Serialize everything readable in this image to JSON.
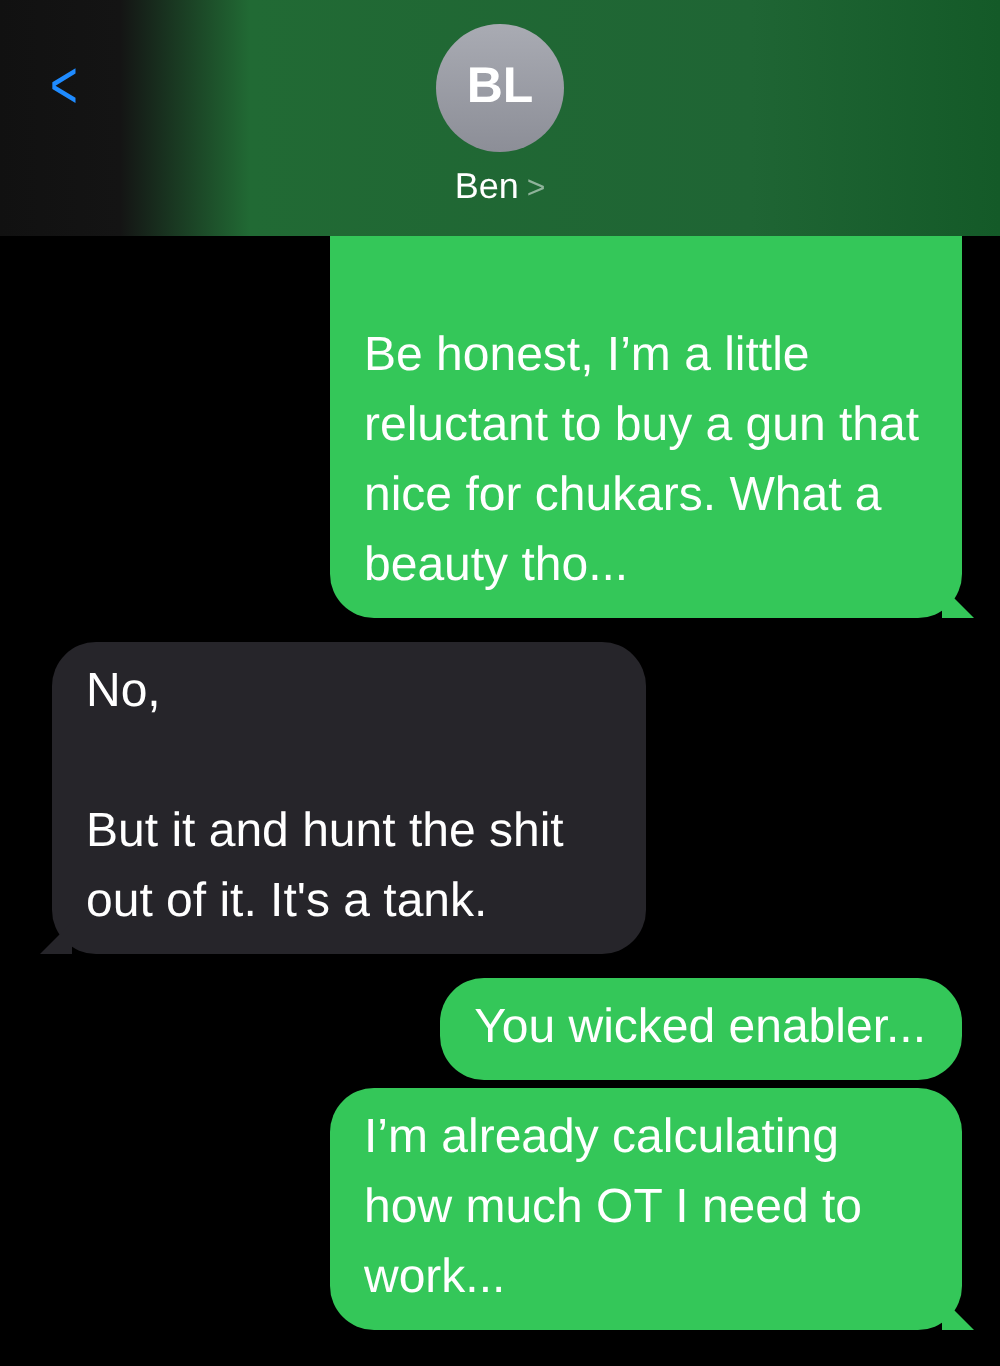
{
  "header": {
    "back": "<",
    "avatar_initials": "BL",
    "contact_name": "Ben",
    "contact_chevron": ">"
  },
  "messages": [
    {
      "kind": "sent",
      "cut_top": true,
      "tail": true,
      "text": "Be honest, I’m a little reluctant to buy a gun that nice for chukars. What a beauty tho..."
    },
    {
      "kind": "received",
      "cut_top": false,
      "tail": true,
      "text": "No,\n\nBut it and hunt the shit out of it. It's a tank."
    },
    {
      "kind": "sent",
      "cut_top": false,
      "tail": false,
      "text": "You wicked enabler..."
    },
    {
      "kind": "sent",
      "cut_top": false,
      "tail": true,
      "text": "I’m already calculating how much OT I need to work..."
    }
  ]
}
